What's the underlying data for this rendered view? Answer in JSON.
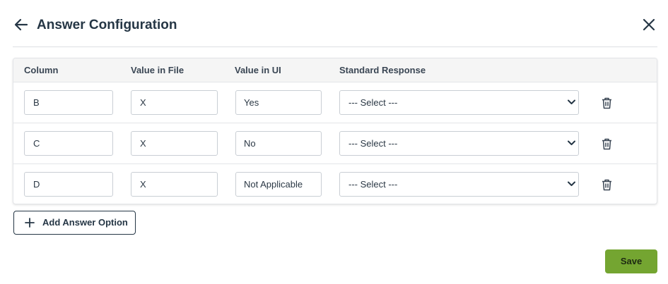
{
  "header": {
    "title": "Answer Configuration",
    "back_icon": "arrow-left-icon",
    "close_icon": "close-icon"
  },
  "table": {
    "columns": [
      "Column",
      "Value in File",
      "Value in UI",
      "Standard Response"
    ],
    "rows": [
      {
        "column": "B",
        "value_in_file": "X",
        "value_in_ui": "Yes",
        "standard_response": "--- Select ---"
      },
      {
        "column": "C",
        "value_in_file": "X",
        "value_in_ui": "No",
        "standard_response": "--- Select ---"
      },
      {
        "column": "D",
        "value_in_file": "X",
        "value_in_ui": "Not Applicable",
        "standard_response": "--- Select ---"
      }
    ],
    "row_action_icon": "trash-icon"
  },
  "actions": {
    "add_label": "Add Answer Option",
    "add_icon": "plus-icon",
    "save_label": "Save"
  },
  "colors": {
    "primary_text": "#253645",
    "save_button": "#74a531",
    "header_background": "#f5f5f5"
  }
}
